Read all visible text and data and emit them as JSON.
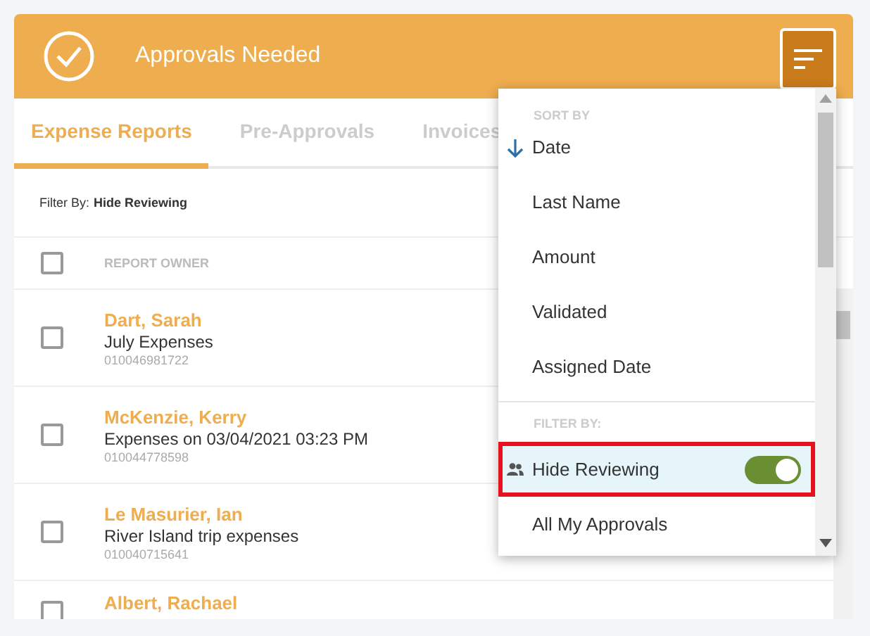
{
  "header": {
    "title": "Approvals Needed"
  },
  "tabs": [
    {
      "label": "Expense Reports",
      "selected": true
    },
    {
      "label": "Pre-Approvals",
      "selected": false
    },
    {
      "label": "Invoices",
      "selected": false
    }
  ],
  "filter": {
    "label": "Filter By:",
    "value": "Hide Reviewing"
  },
  "table": {
    "columns": [
      "REPORT OWNER"
    ],
    "select_all_checked": false,
    "rows": [
      {
        "owner": "Dart, Sarah",
        "title": "July Expenses",
        "id": "010046981722",
        "checked": false
      },
      {
        "owner": "McKenzie, Kerry",
        "title": "Expenses on 03/04/2021 03:23 PM",
        "id": "010044778598",
        "checked": false
      },
      {
        "owner": "Le Masurier, Ian",
        "title": "River Island trip expenses",
        "id": "010040715641",
        "checked": false
      },
      {
        "owner": "Albert, Rachael",
        "checked": false
      }
    ]
  },
  "menu": {
    "sections": [
      {
        "heading": "SORT BY",
        "items": [
          {
            "label": "Date",
            "kind": "sort",
            "sorted": true
          },
          {
            "label": "Last Name",
            "kind": "sort",
            "sorted": false
          },
          {
            "label": "Amount",
            "kind": "sort",
            "sorted": false
          },
          {
            "label": "Validated",
            "kind": "sort",
            "sorted": false
          },
          {
            "label": "Assigned Date",
            "kind": "sort",
            "sorted": false
          }
        ]
      },
      {
        "heading": "FILTER BY:",
        "items": [
          {
            "label": "Hide Reviewing",
            "kind": "toggle",
            "on": true,
            "selected": true
          },
          {
            "label": "All My Approvals",
            "kind": "option",
            "selected": false
          }
        ]
      }
    ]
  }
}
